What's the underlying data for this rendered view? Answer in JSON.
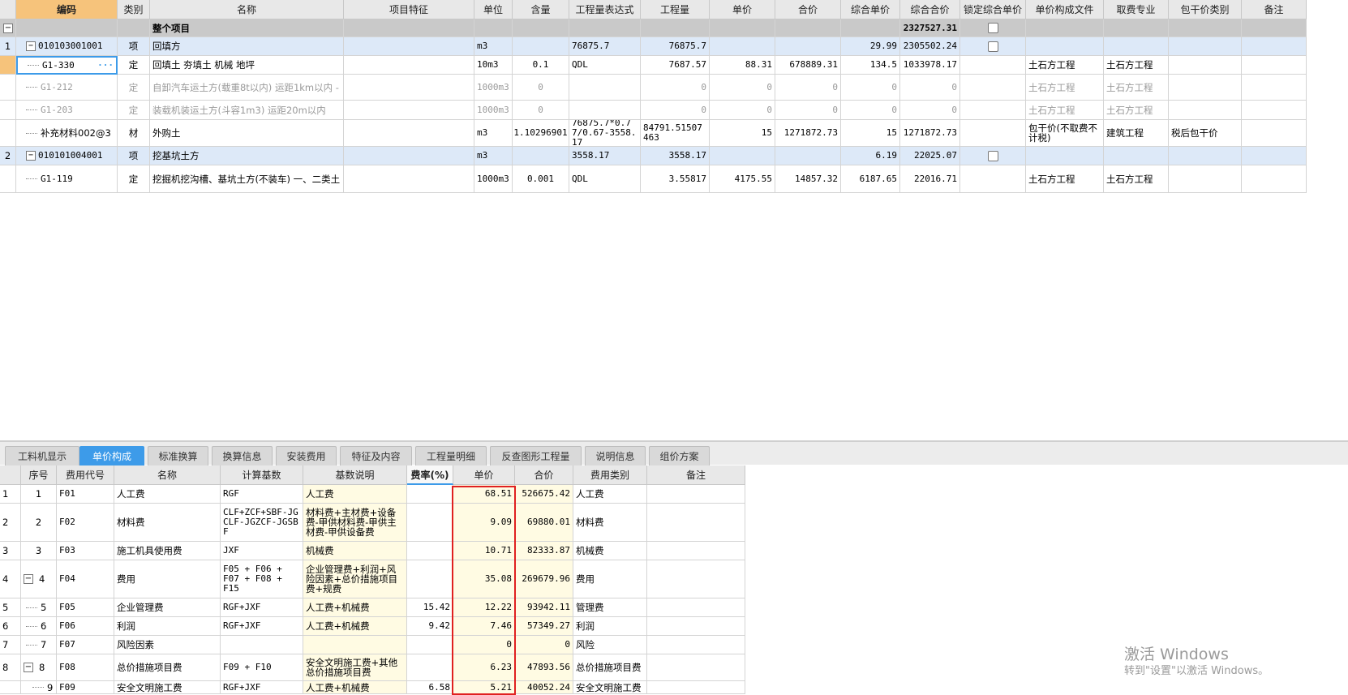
{
  "top_headers": [
    "",
    "编码",
    "类别",
    "名称",
    "项目特征",
    "单位",
    "含量",
    "工程量表达式",
    "工程量",
    "单价",
    "合价",
    "综合单价",
    "综合合价",
    "锁定综合单价",
    "单价构成文件",
    "取费专业",
    "包干价类别",
    "备注"
  ],
  "top_rows": [
    {
      "num": "",
      "code": "",
      "type": "",
      "name": "整个项目",
      "unit": "",
      "content": "",
      "expr": "",
      "qty": "",
      "price": "",
      "total": "",
      "unit_total": "",
      "comp_total": "2327527.31",
      "comp_file": "",
      "fee": "",
      "pkg": ""
    },
    {
      "num": "1",
      "code": "010103001001",
      "type": "项",
      "name": "回填方",
      "unit": "m3",
      "content": "",
      "expr": "76875.7",
      "qty": "76875.7",
      "price": "",
      "total": "",
      "unit_total": "29.99",
      "comp_total": "2305502.24",
      "comp_file": "",
      "fee": "",
      "pkg": ""
    },
    {
      "num": "",
      "code": "G1-330",
      "type": "定",
      "name": "回填土 夯填土 机械 地坪",
      "unit": "10m3",
      "content": "0.1",
      "expr": "QDL",
      "qty": "7687.57",
      "price": "88.31",
      "total": "678889.31",
      "unit_total": "134.5",
      "comp_total": "1033978.17",
      "comp_file": "土石方工程",
      "fee": "土石方工程",
      "pkg": ""
    },
    {
      "num": "",
      "code": "G1-212",
      "type": "定",
      "name": "自卸汽车运土方(载重8t以内) 运距1km以内 -",
      "unit": "1000m3",
      "content": "0",
      "expr": "",
      "qty": "0",
      "price": "0",
      "total": "0",
      "unit_total": "0",
      "comp_total": "0",
      "comp_file": "土石方工程",
      "fee": "土石方工程",
      "pkg": ""
    },
    {
      "num": "",
      "code": "G1-203",
      "type": "定",
      "name": "装载机装运土方(斗容1m3) 运距20m以内",
      "unit": "1000m3",
      "content": "0",
      "expr": "",
      "qty": "0",
      "price": "0",
      "total": "0",
      "unit_total": "0",
      "comp_total": "0",
      "comp_file": "土石方工程",
      "fee": "土石方工程",
      "pkg": ""
    },
    {
      "num": "",
      "code": "补充材料002@3",
      "type": "材",
      "name": "外购土",
      "unit": "m3",
      "content": "1.10296901",
      "expr": "76875.7*0.77/0.67-3558.17",
      "qty": "84791.51507463",
      "price": "15",
      "total": "1271872.73",
      "unit_total": "15",
      "comp_total": "1271872.73",
      "comp_file": "包干价(不取费不计税)",
      "fee": "建筑工程",
      "pkg": "税后包干价"
    },
    {
      "num": "2",
      "code": "010101004001",
      "type": "项",
      "name": "挖基坑土方",
      "unit": "m3",
      "content": "",
      "expr": "3558.17",
      "qty": "3558.17",
      "price": "",
      "total": "",
      "unit_total": "6.19",
      "comp_total": "22025.07",
      "comp_file": "",
      "fee": "",
      "pkg": ""
    },
    {
      "num": "",
      "code": "G1-119",
      "type": "定",
      "name": "挖掘机挖沟槽、基坑土方(不装车) 一、二类土",
      "unit": "1000m3",
      "content": "0.001",
      "expr": "QDL",
      "qty": "3.55817",
      "price": "4175.55",
      "total": "14857.32",
      "unit_total": "6187.65",
      "comp_total": "22016.71",
      "comp_file": "土石方工程",
      "fee": "土石方工程",
      "pkg": ""
    }
  ],
  "tabs": [
    "工料机显示",
    "单价构成",
    "标准换算",
    "换算信息",
    "安装费用",
    "特征及内容",
    "工程量明细",
    "反查图形工程量",
    "说明信息",
    "组价方案"
  ],
  "bottom_headers": [
    "",
    "序号",
    "费用代号",
    "名称",
    "计算基数",
    "基数说明",
    "费率(%)",
    "单价",
    "合价",
    "费用类别",
    "备注"
  ],
  "bottom_rows": [
    {
      "num": "1",
      "seq": "1",
      "code": "F01",
      "name": "人工费",
      "base": "RGF",
      "desc": "人工费",
      "rate": "",
      "price": "68.51",
      "total": "526675.42",
      "cat": "人工费"
    },
    {
      "num": "2",
      "seq": "2",
      "code": "F02",
      "name": "材料费",
      "base": "CLF+ZCF+SBF-JGCLF-JGZCF-JGSBF",
      "desc": "材料费+主材费+设备费-甲供材料费-甲供主材费-甲供设备费",
      "rate": "",
      "price": "9.09",
      "total": "69880.01",
      "cat": "材料费"
    },
    {
      "num": "3",
      "seq": "3",
      "code": "F03",
      "name": "施工机具使用费",
      "base": "JXF",
      "desc": "机械费",
      "rate": "",
      "price": "10.71",
      "total": "82333.87",
      "cat": "机械费"
    },
    {
      "num": "4",
      "seq": "4",
      "code": "F04",
      "name": "费用",
      "base": "F05 + F06 + F07 + F08 + F15",
      "desc": "企业管理费+利润+风险因素+总价措施项目费+规费",
      "rate": "",
      "price": "35.08",
      "total": "269679.96",
      "cat": "费用"
    },
    {
      "num": "5",
      "seq": "5",
      "code": "F05",
      "name": "企业管理费",
      "base": "RGF+JXF",
      "desc": "人工费+机械费",
      "rate": "15.42",
      "price": "12.22",
      "total": "93942.11",
      "cat": "管理费"
    },
    {
      "num": "6",
      "seq": "6",
      "code": "F06",
      "name": "利润",
      "base": "RGF+JXF",
      "desc": "人工费+机械费",
      "rate": "9.42",
      "price": "7.46",
      "total": "57349.27",
      "cat": "利润"
    },
    {
      "num": "7",
      "seq": "7",
      "code": "F07",
      "name": "风险因素",
      "base": "",
      "desc": "",
      "rate": "",
      "price": "0",
      "total": "0",
      "cat": "风险"
    },
    {
      "num": "8",
      "seq": "8",
      "code": "F08",
      "name": "总价措施项目费",
      "base": "F09 + F10",
      "desc": "安全文明施工费+其他总价措施项目费",
      "rate": "",
      "price": "6.23",
      "total": "47893.56",
      "cat": "总价措施项目费"
    },
    {
      "num": "",
      "seq": "9",
      "code": "F09",
      "name": "安全文明施工费",
      "base": "RGF+JXF",
      "desc": "人工费+机械费",
      "rate": "6.58",
      "price": "5.21",
      "total": "40052.24",
      "cat": "安全文明施工费"
    }
  ],
  "watermark": {
    "line1": "激活 Windows",
    "line2": "转到\"设置\"以激活 Windows。"
  },
  "colors": {
    "accent": "#3d9be9",
    "highlight_border": "#e02020",
    "selected_row": "#dde9f8",
    "group_row": "#c9c9c9"
  },
  "icons": {
    "collapse": "minus-box-icon",
    "more": "ellipsis-icon"
  }
}
